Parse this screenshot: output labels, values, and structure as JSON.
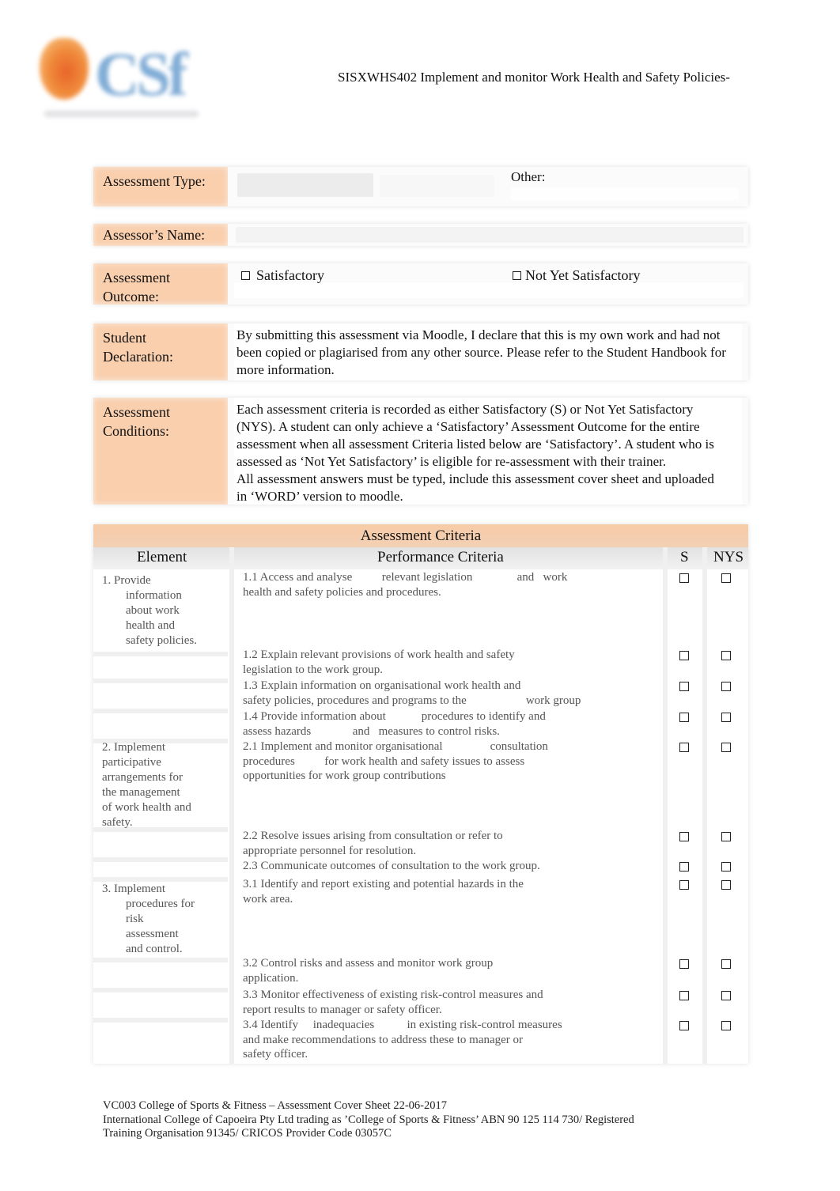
{
  "logo": {
    "text": "CSf",
    "name": "College of Sports & Fitness logo"
  },
  "header": {
    "unit_title": "SISXWHS402 Implement and monitor Work Health and Safety Policies-"
  },
  "form": {
    "assessment_type": {
      "label": "Assessment Type:",
      "other_label": "Other:",
      "value": "",
      "other_value": ""
    },
    "assessor_name": {
      "label": "Assessor’s Name:",
      "value": ""
    },
    "assessment_outcome": {
      "label_line1": "Assessment",
      "label_line2": "Outcome:",
      "options": [
        {
          "label": "Satisfactory",
          "checked": false
        },
        {
          "label": "Not Yet Satisfactory",
          "checked": false
        }
      ]
    },
    "student_declaration": {
      "label_line1": "Student",
      "label_line2": "Declaration:",
      "text": "By submitting this assessment via Moodle, I declare that this is my own work and had not been copied or plagiarised from any other source. Please refer to the Student Handbook for more information."
    },
    "assessment_conditions": {
      "label_line1": "Assessment",
      "label_line2": "Conditions:",
      "text_p1": "Each assessment criteria is recorded as either Satisfactory (S) or Not Yet Satisfactory (NYS). A student can only achieve a ‘Satisfactory’ Assessment Outcome for the entire assessment when all assessment Criteria listed below are ‘Satisfactory’. A student who is assessed as ‘Not Yet Satisfactory’ is eligible for re-assessment with their trainer.",
      "text_p2": "All assessment answers must be typed, include this assessment cover sheet and uploaded in ‘WORD’ version to moodle."
    }
  },
  "criteria": {
    "title": "Assessment Criteria",
    "columns": {
      "element": "Element",
      "performance": "Performance Criteria",
      "s": "S",
      "nys": "NYS"
    },
    "elements": [
      {
        "first": "1. Provide",
        "rest": [
          "information",
          "about work",
          "health and",
          "safety policies."
        ]
      },
      {
        "first": "2. Implement",
        "rest": [
          "participative",
          "arrangements for",
          "the management",
          "of work health and",
          "safety."
        ]
      },
      {
        "first": "3. Implement",
        "rest": [
          "procedures for",
          "risk",
          "assessment",
          "and control."
        ]
      }
    ],
    "rows": [
      {
        "text": "1.1 Access and analyse          relevant legislation               and   work\nhealth and safety policies and procedures.",
        "s": false,
        "nys": false
      },
      {
        "text": "1.2 Explain relevant provisions of work health and safety\nlegislation to the work group.",
        "s": false,
        "nys": false
      },
      {
        "text": "1.3 Explain information on organisational work health and\nsafety policies, procedures and programs to the                    work group",
        "s": false,
        "nys": false
      },
      {
        "text": "1.4 Provide information about            procedures to identify and\nassess hazards              and   measures to control risks.",
        "s": false,
        "nys": false
      },
      {
        "text": "2.1 Implement and monitor organisational                consultation\nprocedures          for work health and safety issues to assess\nopportunities for work group contributions",
        "s": false,
        "nys": false
      },
      {
        "text": "2.2 Resolve issues arising from consultation or refer to\nappropriate personnel for resolution.",
        "s": false,
        "nys": false
      },
      {
        "text": "2.3 Communicate outcomes of consultation to the work group.",
        "s": false,
        "nys": false
      },
      {
        "text": "3.1 Identify and report existing and potential hazards in the\nwork area.",
        "s": false,
        "nys": false
      },
      {
        "text": "3.2 Control risks and assess and monitor work group\napplication.",
        "s": false,
        "nys": false
      },
      {
        "text": "3.3 Monitor effectiveness of existing risk-control measures and\nreport results to manager or safety officer.",
        "s": false,
        "nys": false
      },
      {
        "text": "3.4 Identify     inadequacies           in existing risk-control measures\nand make recommendations to address these to manager or\nsafety officer.",
        "s": false,
        "nys": false
      }
    ]
  },
  "footer": {
    "line1": "VC003 College of Sports & Fitness – Assessment Cover Sheet 22-06-2017",
    "line2": "International College of Capoeira Pty Ltd trading as ’College of Sports & Fitness’ ABN 90 125 114 730/ Registered",
    "line3": "Training Organisation 91345/ CRICOS Provider Code 03057C"
  },
  "colors": {
    "label_bg": "#f9cfae",
    "title_bg": "#f6cba7",
    "text": "#111111",
    "criteria_text": "#555555"
  }
}
